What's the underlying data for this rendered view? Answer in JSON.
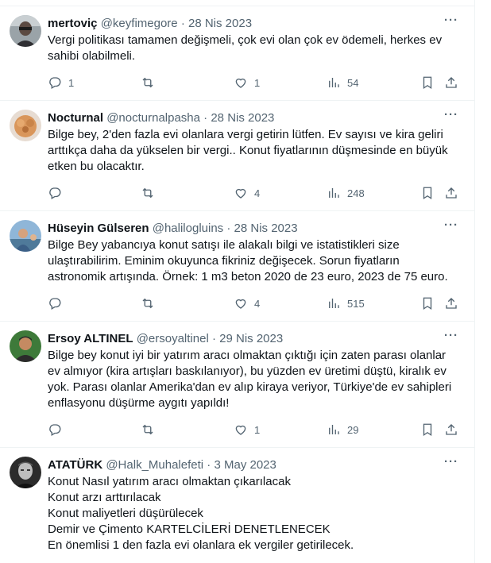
{
  "tweets": [
    {
      "name": "mertoviç",
      "handle": "@keyfimegore",
      "date": "28 Nis 2023",
      "lines": [
        "Vergi politikası tamamen değişmeli, çok evi olan çok ev ödemeli, herkes ev",
        "sahibi olabilmeli."
      ],
      "replies": "1",
      "retweets": "",
      "likes": "1",
      "views": "54",
      "avatar_icon": "person-avatar-icon"
    },
    {
      "name": "Nocturnal",
      "handle": "@nocturnalpasha",
      "date": "28 Nis 2023",
      "lines": [
        "Bilge bey, 2'den fazla evi olanlara vergi getirin lütfen. Ev sayısı ve kira geliri",
        "arttıkça daha da yükselen bir vergi.. Konut fiyatlarının düşmesinde en büyük",
        "etken bu olacaktır."
      ],
      "replies": "",
      "retweets": "",
      "likes": "4",
      "views": "248",
      "avatar_icon": "dog-avatar-icon"
    },
    {
      "name": "Hüseyin Gülseren",
      "handle": "@halilogluins",
      "date": "28 Nis 2023",
      "lines": [
        "Bilge Bey yabancıya konut satışı ile alakalı bilgi ve istatistikleri size",
        "ulaştırabilirim. Eminim okuyunca fikriniz değişecek. Sorun fiyatların",
        "astronomik artışında. Örnek: 1 m3 beton 2020 de 23 euro, 2023 de 75 euro."
      ],
      "replies": "",
      "retweets": "",
      "likes": "4",
      "views": "515",
      "avatar_icon": "outdoor-avatar-icon"
    },
    {
      "name": "Ersoy ALTINEL",
      "handle": "@ersoyaltinel",
      "date": "29 Nis 2023",
      "lines": [
        "Bilge bey konut iyi bir yatırım aracı olmaktan çıktığı için zaten parası olanlar",
        "ev almıyor (kira artışları baskılanıyor), bu yüzden ev üretimi düştü, kiralık ev",
        "yok. Parası olanlar Amerika'dan ev alıp kiraya veriyor, Türkiye'de ev sahipleri",
        "enflasyonu düşürme aygıtı yapıldı!"
      ],
      "replies": "",
      "retweets": "",
      "likes": "1",
      "views": "29",
      "avatar_icon": "person-avatar-icon"
    },
    {
      "name": "ATATÜRK",
      "handle": "@Halk_Muhalefeti",
      "date": "3 May 2023",
      "lines": [
        "Konut Nasıl yatırım aracı olmaktan çıkarılacak",
        "Konut arzı arttırılacak",
        "Konut maliyetleri düşürülecek",
        "Demir ve Çimento KARTELCİLERİ DENETLENECEK",
        "En önemlisi 1 den fazla evi olanlara ek vergiler getirilecek."
      ],
      "avatar_icon": "portrait-avatar-icon"
    }
  ]
}
